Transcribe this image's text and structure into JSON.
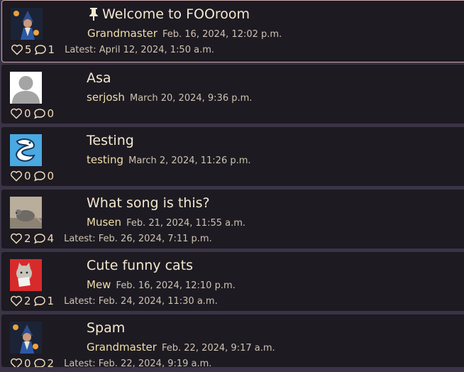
{
  "posts": [
    {
      "title": "Welcome to FOOroom",
      "pinned": true,
      "author": "Grandmaster",
      "date": "Feb. 16, 2024, 12:02 p.m.",
      "likes": "5",
      "comments": "1",
      "latest": "Latest: April 12, 2024, 1:50 a.m.",
      "avatar": "wizard"
    },
    {
      "title": "Asa",
      "pinned": false,
      "author": "serjosh",
      "date": "March 20, 2024, 9:36 p.m.",
      "likes": "0",
      "comments": "0",
      "latest": "",
      "avatar": "default-user"
    },
    {
      "title": "Testing",
      "pinned": false,
      "author": "testing",
      "date": "March 2, 2024, 11:26 p.m.",
      "likes": "0",
      "comments": "0",
      "latest": "",
      "avatar": "blue-dragon"
    },
    {
      "title": "What song is this?",
      "pinned": false,
      "author": "Musen",
      "date": "Feb. 21, 2024, 11:55 a.m.",
      "likes": "2",
      "comments": "4",
      "latest": "Latest: Feb. 26, 2024, 7:11 p.m.",
      "avatar": "mouse"
    },
    {
      "title": "Cute funny cats",
      "pinned": false,
      "author": "Mew",
      "date": "Feb. 16, 2024, 12:10 p.m.",
      "likes": "2",
      "comments": "1",
      "latest": "Latest: Feb. 24, 2024, 11:30 a.m.",
      "avatar": "cat"
    },
    {
      "title": "Spam",
      "pinned": false,
      "author": "Grandmaster",
      "date": "Feb. 22, 2024, 9:17 a.m.",
      "likes": "0",
      "comments": "2",
      "latest": "Latest: Feb. 22, 2024, 9:19 a.m.",
      "avatar": "wizard"
    }
  ],
  "colors": {
    "background": "#3b3346",
    "card": "#1d1a22",
    "title": "#f4e9cf",
    "author": "#f1dfa8",
    "pinned_border": "#cfa9ac"
  }
}
